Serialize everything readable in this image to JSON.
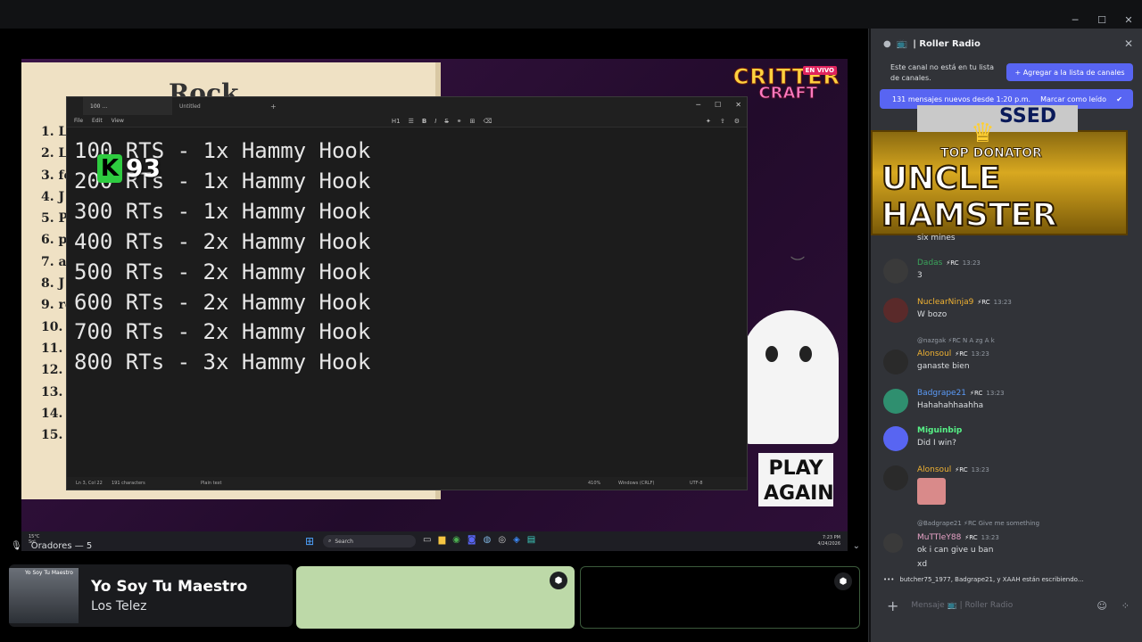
{
  "window_controls": [
    "─",
    "☐",
    "✕"
  ],
  "stream": {
    "book_title": "Rock",
    "book_items": [
      "1. Li",
      "2. Ll",
      "3. fo",
      "4. J",
      "5. Po",
      "6. p",
      "7. al",
      "8. J",
      "9. re",
      "10. w",
      "11. f",
      "12. f",
      "13. c",
      "14. r",
      "15. N"
    ],
    "overlay_live": "EN VIVO",
    "overlay_brand_1": "CRITTER",
    "overlay_brand_2": "CRAFT",
    "play_again": "PLAY AGAIN",
    "k_badge": "K",
    "k_number": "93"
  },
  "notepad": {
    "tab_1": "100 …",
    "tab_2": "Untitled",
    "menu": [
      "File",
      "Edit",
      "View"
    ],
    "heading_select": "H1",
    "lines": [
      "100 RTS - 1x Hammy Hook",
      "200 RTs - 1x Hammy Hook",
      "300 RTs - 1x Hammy Hook",
      "400 RTs - 2x Hammy Hook",
      "500 RTs - 2x Hammy Hook",
      "600 RTs - 2x Hammy Hook",
      "700 RTs - 2x Hammy Hook",
      "800 RTs - 3x Hammy Hook"
    ],
    "status": {
      "position": "Ln 3, Col 22",
      "chars": "191 characters",
      "format": "Plain text",
      "zoom": "410%",
      "eol": "Windows (CRLF)",
      "encoding": "UTF-8"
    }
  },
  "taskbar": {
    "temp": "15°C",
    "weather": "Sol",
    "search": "Search",
    "time": "7:23 PM",
    "date": "4/24/2026"
  },
  "speakers": {
    "label": "Oradores — 5",
    "song_title": "Yo Soy Tu Maestro",
    "song_artist": "Los Telez",
    "album_text": "Yo Soy Tu Maestro"
  },
  "panel": {
    "channel_name": "Roller Radio",
    "notice_text": "Este canal no está en tu lista de canales.",
    "add_button": "Agregar a la lista de canales",
    "new_messages": "131 mensajes nuevos desde 1:20 p.m.",
    "mark_read": "Marcar como leído",
    "banner_top": "TOP DONATOR",
    "banner_name": "UNCLE HAMSTER",
    "banner_back": "SSED",
    "cut_text": "six mines",
    "messages": [
      {
        "name": "Dadas",
        "color": "#3ba55c",
        "tags": "⚡RC",
        "time": "13:23",
        "body": "3",
        "avatar": "#3a3a3a"
      },
      {
        "name": "NuclearNinja9",
        "color": "#f0b232",
        "tags": "⚡RC",
        "time": "13:23",
        "body": "W bozo",
        "avatar": "#5a2a2a"
      },
      {
        "name": "Alonsoul",
        "color": "#f0b232",
        "tags": "⚡RC",
        "time": "13:23",
        "body": "ganaste bien",
        "avatar": "#2a2a2a",
        "reply": "@nazgak ⚡RC N A zg A k"
      },
      {
        "name": "Badgrape21",
        "color": "#5b9bf8",
        "tags": "⚡RC",
        "time": "13:23",
        "body": "Hahahahhaahha",
        "avatar": "#2f8f6f"
      },
      {
        "name": "Miguinbip",
        "color": "#57f287",
        "tags": "",
        "time": "",
        "body": "Did I win?",
        "avatar": "#5865f2"
      },
      {
        "name": "Alonsoul",
        "color": "#f0b232",
        "tags": "⚡RC",
        "time": "13:23",
        "body": "",
        "avatar": "#2a2a2a"
      },
      {
        "name": "MuTTleY88",
        "color": "#e8a3c7",
        "tags": "⚡RC",
        "time": "13:23",
        "body": "ok i can give u ban",
        "body2": "xd",
        "avatar": "#3a3a3a",
        "reply": "@Badgrape21 ⚡RC Give me something"
      }
    ],
    "typing": "butcher75_1977, Badgrape21, y XAAH están escribiendo...",
    "composer_placeholder": "Mensaje 📺 | Roller Radio"
  },
  "colors": {
    "discord_blurple": "#5865f2",
    "panel_bg": "#313338",
    "notepad_bg": "#1c1c1c"
  }
}
